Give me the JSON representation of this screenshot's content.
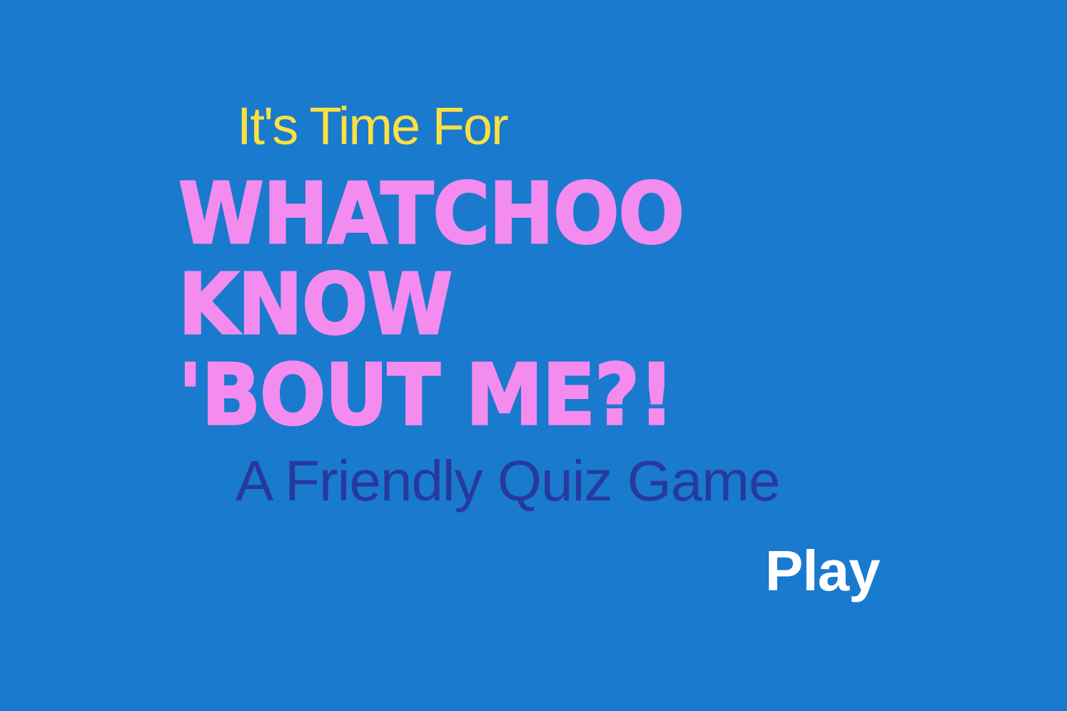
{
  "title_screen": {
    "pretitle": "It's Time For",
    "title_lines": [
      "WHATCHOO",
      "KNOW",
      "'BOUT ME?!"
    ],
    "subtitle": "A Friendly Quiz Game",
    "play_label": "Play"
  },
  "colors": {
    "background": "#1a7acd",
    "pretitle": "#fce043",
    "title": "#f48cf0",
    "subtitle": "#263a9e",
    "play": "#ffffff"
  }
}
